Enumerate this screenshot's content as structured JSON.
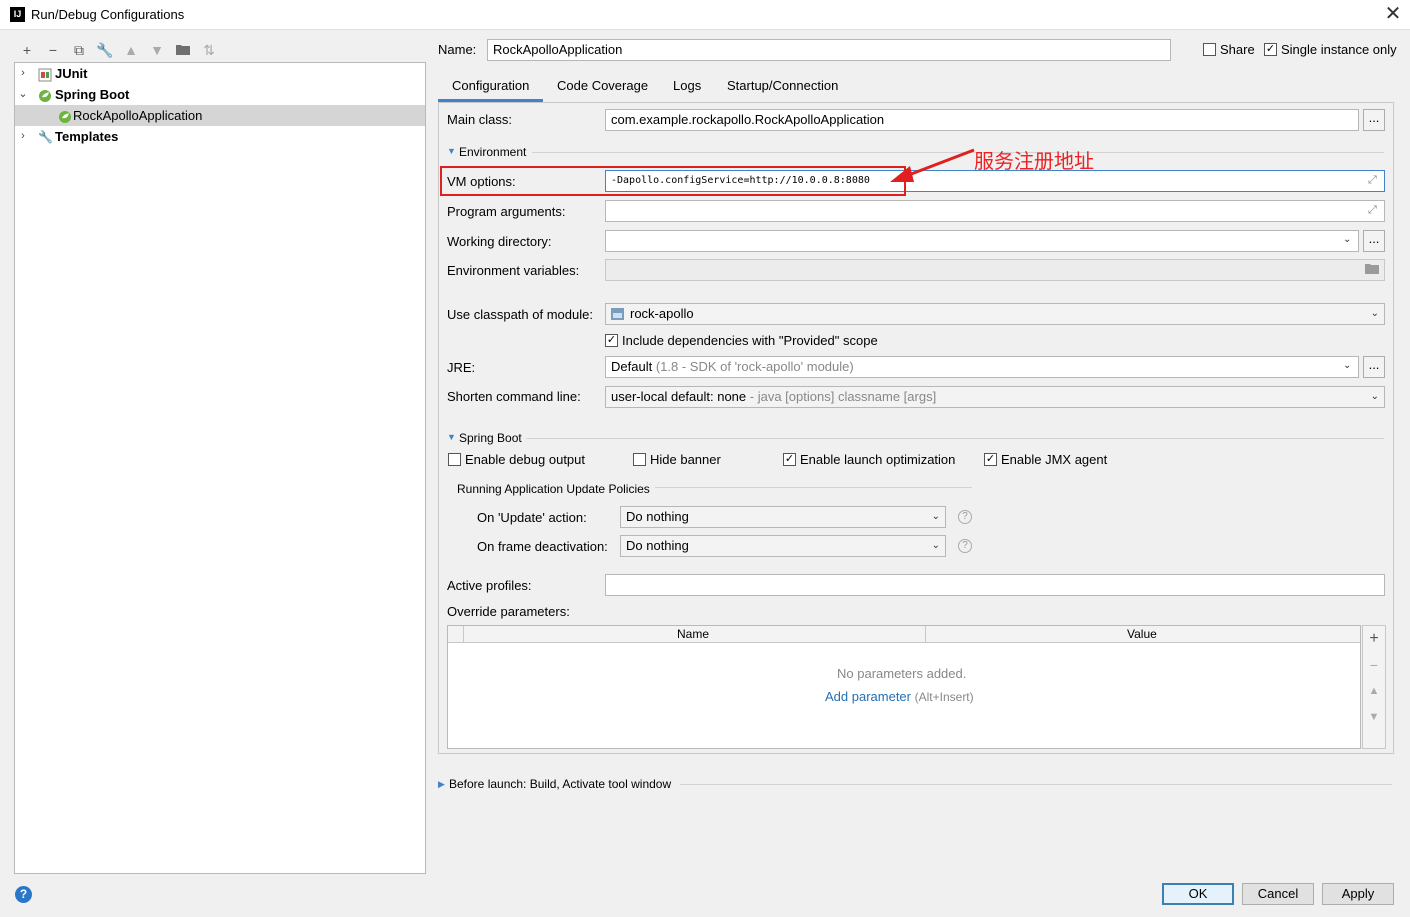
{
  "window": {
    "title": "Run/Debug Configurations",
    "app_icon": "IJ"
  },
  "toolbar": {
    "icons": [
      "add-icon",
      "remove-icon",
      "copy-icon",
      "wrench-icon",
      "move-up-icon",
      "move-down-icon",
      "folder-icon",
      "sort-icon"
    ]
  },
  "tree": {
    "items": [
      {
        "label": "JUnit"
      },
      {
        "label": "Spring Boot"
      },
      {
        "label": "RockApolloApplication"
      },
      {
        "label": "Templates"
      }
    ]
  },
  "header": {
    "name_label": "Name:",
    "name_value": "RockApolloApplication",
    "share_label": "Share",
    "single_instance_label": "Single instance only"
  },
  "tabs": [
    "Configuration",
    "Code Coverage",
    "Logs",
    "Startup/Connection"
  ],
  "config": {
    "main_class_label": "Main class:",
    "main_class_value": "com.example.rockapollo.RockApolloApplication",
    "environment_section": "Environment",
    "vm_options_label": "VM options:",
    "vm_options_value": "-Dapollo.configService=http://10.0.0.8:8080",
    "program_args_label": "Program arguments:",
    "working_dir_label": "Working directory:",
    "env_vars_label": "Environment variables:",
    "classpath_label": "Use classpath of module:",
    "classpath_value": "rock-apollo",
    "include_deps_label": "Include dependencies with \"Provided\" scope",
    "jre_label": "JRE:",
    "jre_value": "Default",
    "jre_hint": "(1.8 - SDK of 'rock-apollo' module)",
    "shorten_label": "Shorten command line:",
    "shorten_value": "user-local default: none",
    "shorten_hint": "- java [options] classname [args]",
    "spring_boot_section": "Spring Boot",
    "enable_debug_label": "Enable debug output",
    "hide_banner_label": "Hide banner",
    "launch_opt_label": "Enable launch optimization",
    "jmx_label": "Enable JMX agent",
    "update_policies_label": "Running Application Update Policies",
    "on_update_label": "On 'Update' action:",
    "on_update_value": "Do nothing",
    "on_frame_label": "On frame deactivation:",
    "on_frame_value": "Do nothing",
    "active_profiles_label": "Active profiles:",
    "override_label": "Override parameters:",
    "table_col_name": "Name",
    "table_col_value": "Value",
    "no_params": "No parameters added.",
    "add_param_link": "Add parameter",
    "add_param_hint": "(Alt+Insert)"
  },
  "before_launch": "Before launch: Build, Activate tool window",
  "annotation": "服务注册地址",
  "buttons": {
    "ok": "OK",
    "cancel": "Cancel",
    "apply": "Apply"
  },
  "colors": {
    "accent": "#4083c9",
    "link": "#2470b3",
    "annotation": "#e02020"
  }
}
